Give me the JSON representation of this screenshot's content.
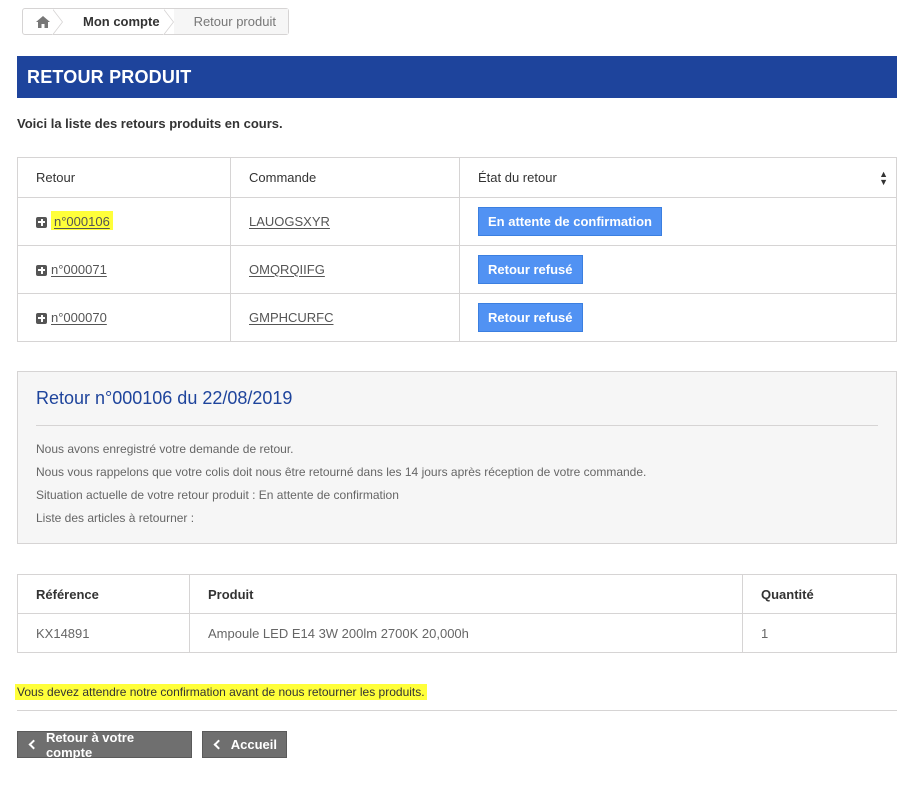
{
  "breadcrumb": {
    "home_icon": "home-icon",
    "account": "Mon compte",
    "current": "Retour produit"
  },
  "page_title": "RETOUR PRODUIT",
  "intro": "Voici la liste des retours produits en cours.",
  "returns_table": {
    "headers": [
      "Retour",
      "Commande",
      "État du retour"
    ],
    "rows": [
      {
        "return_no": "n°000106",
        "order": "LAUOGSXYR",
        "status": "En attente de confirmation"
      },
      {
        "return_no": "n°000071",
        "order": "OMQRQIIFG",
        "status": "Retour refusé"
      },
      {
        "return_no": "n°000070",
        "order": "GMPHCURFC",
        "status": "Retour refusé"
      }
    ]
  },
  "detail": {
    "title": "Retour n°000106 du 22/08/2019",
    "lines": [
      "Nous avons enregistré votre demande de retour.",
      "Nous vous rappelons que votre colis doit nous être retourné dans les 14 jours après réception de votre commande.",
      "Situation actuelle de votre retour produit : En attente de confirmation",
      "Liste des articles à retourner :"
    ]
  },
  "items_table": {
    "headers": [
      "Référence",
      "Produit",
      "Quantité"
    ],
    "rows": [
      {
        "ref": "KX14891",
        "product": "Ampoule LED E14 3W 200lm 2700K 20,000h",
        "qty": "1"
      }
    ]
  },
  "warning": "Vous devez attendre notre confirmation avant de nous retourner les produits.",
  "buttons": {
    "back_account": "Retour à votre compte",
    "home": "Accueil"
  },
  "colors": {
    "title_bar": "#1e449c",
    "status_button": "#5192f3",
    "highlight": "#ffff3a",
    "nav_button": "#6f6f6f"
  }
}
